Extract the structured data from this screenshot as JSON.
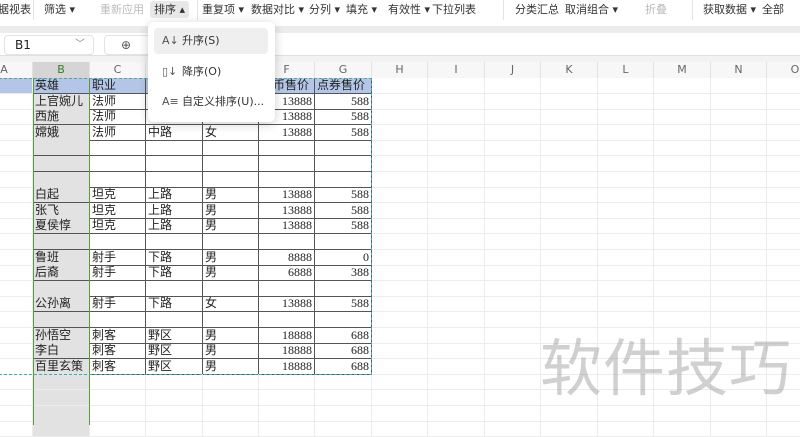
{
  "toolbar": {
    "items": [
      {
        "label": "据视表",
        "state": "normal"
      },
      {
        "label": "筛选 ▾",
        "state": "normal"
      },
      {
        "label": "重新应用",
        "state": "disabled"
      },
      {
        "label": "排序 ▴",
        "state": "active"
      },
      {
        "label": "重复项 ▾",
        "state": "normal"
      },
      {
        "label": "数据对比 ▾",
        "state": "normal"
      },
      {
        "label": "分列 ▾",
        "state": "normal"
      },
      {
        "label": "填充 ▾",
        "state": "normal"
      },
      {
        "label": "有效性 ▾",
        "state": "normal"
      },
      {
        "label": "下拉列表",
        "state": "normal"
      },
      {
        "label": "分类汇总",
        "state": "normal"
      },
      {
        "label": "取消组合 ▾",
        "state": "normal"
      },
      {
        "label": "折叠",
        "state": "disabled"
      },
      {
        "label": "获取数据 ▾",
        "state": "normal"
      },
      {
        "label": "全部",
        "state": "normal"
      }
    ]
  },
  "formula_bar": {
    "name_box": "B1"
  },
  "columns": [
    "A",
    "B",
    "C",
    "D",
    "E",
    "F",
    "G",
    "H",
    "I",
    "J",
    "K",
    "L",
    "M",
    "N",
    "O"
  ],
  "selected_column": "B",
  "table": {
    "header": [
      "",
      "英雄",
      "职业",
      "",
      "",
      "金币售价",
      "点券售价"
    ],
    "rows": [
      [
        "",
        "上官婉儿",
        "法师",
        "",
        "",
        "13888",
        "588"
      ],
      [
        "",
        "西施",
        "法师",
        "",
        "",
        "13888",
        "588"
      ],
      [
        "",
        "嫦娥",
        "法师",
        "中路",
        "女",
        "13888",
        "588"
      ],
      [
        "",
        "",
        "",
        "",
        "",
        "",
        ""
      ],
      [
        "",
        "",
        "",
        "",
        "",
        "",
        ""
      ],
      [
        "",
        "",
        "",
        "",
        "",
        "",
        ""
      ],
      [
        "",
        "白起",
        "坦克",
        "上路",
        "男",
        "13888",
        "588"
      ],
      [
        "",
        "张飞",
        "坦克",
        "上路",
        "男",
        "13888",
        "588"
      ],
      [
        "",
        "夏侯惇",
        "坦克",
        "上路",
        "男",
        "13888",
        "588"
      ],
      [
        "",
        "",
        "",
        "",
        "",
        "",
        ""
      ],
      [
        "",
        "鲁班",
        "射手",
        "下路",
        "男",
        "8888",
        "0"
      ],
      [
        "",
        "后裔",
        "射手",
        "下路",
        "男",
        "6888",
        "388"
      ],
      [
        "",
        "",
        "",
        "",
        "",
        "",
        ""
      ],
      [
        "",
        "公孙离",
        "射手",
        "下路",
        "女",
        "13888",
        "588"
      ],
      [
        "",
        "",
        "",
        "",
        "",
        "",
        ""
      ],
      [
        "",
        "孙悟空",
        "刺客",
        "野区",
        "男",
        "18888",
        "688"
      ],
      [
        "",
        "李白",
        "刺客",
        "野区",
        "男",
        "18888",
        "688"
      ],
      [
        "",
        "百里玄策",
        "刺客",
        "野区",
        "男",
        "18888",
        "688"
      ]
    ]
  },
  "sort_menu": {
    "items": [
      {
        "label": "升序(S)",
        "icon": "sort-ascending-icon"
      },
      {
        "label": "降序(O)",
        "icon": "sort-descending-icon"
      },
      {
        "label": "自定义排序(U)...",
        "icon": "custom-sort-icon"
      }
    ]
  },
  "watermark": "软件技巧",
  "colors": {
    "header_fill": "#b4c6e7",
    "selection": "#5a9a3a"
  }
}
